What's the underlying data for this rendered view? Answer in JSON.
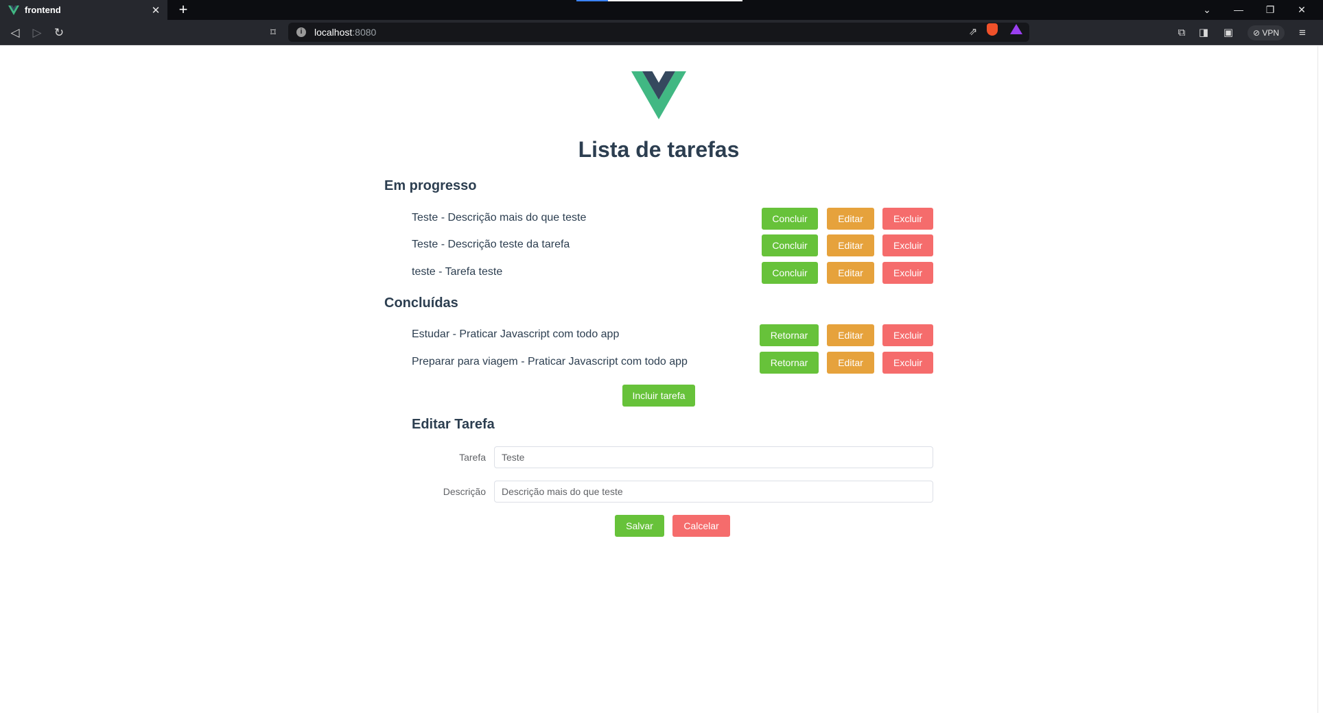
{
  "browser": {
    "tab_title": "frontend",
    "tab_close": "✕",
    "new_tab": "+",
    "url_host": "localhost",
    "url_port": ":8080",
    "vpn_label": "VPN",
    "window_controls": [
      "⌄",
      "—",
      "❐",
      "✕"
    ]
  },
  "app": {
    "title": "Lista de tarefas",
    "in_progress": {
      "heading": "Em progresso",
      "tasks": [
        {
          "text": "Teste - Descrição mais do que teste",
          "primary": "Concluir",
          "edit": "Editar",
          "delete": "Excluir"
        },
        {
          "text": "Teste - Descrição teste da tarefa",
          "primary": "Concluir",
          "edit": "Editar",
          "delete": "Excluir"
        },
        {
          "text": "teste - Tarefa teste",
          "primary": "Concluir",
          "edit": "Editar",
          "delete": "Excluir"
        }
      ]
    },
    "completed": {
      "heading": "Concluídas",
      "tasks": [
        {
          "text": "Estudar - Praticar Javascript com todo app",
          "primary": "Retornar",
          "edit": "Editar",
          "delete": "Excluir"
        },
        {
          "text": "Preparar para viagem - Praticar Javascript com todo app",
          "primary": "Retornar",
          "edit": "Editar",
          "delete": "Excluir"
        }
      ]
    },
    "add_task_label": "Incluir tarefa",
    "edit_form": {
      "heading": "Editar Tarefa",
      "task_label": "Tarefa",
      "task_value": "Teste",
      "description_label": "Descrição",
      "description_value": "Descrição mais do que teste",
      "save_label": "Salvar",
      "cancel_label": "Calcelar"
    }
  },
  "colors": {
    "success": "#67c23a",
    "warning": "#e6a23c",
    "danger": "#f56c6c",
    "heading": "#2c3e50",
    "vue_green": "#41b883",
    "vue_dark": "#35495e"
  }
}
